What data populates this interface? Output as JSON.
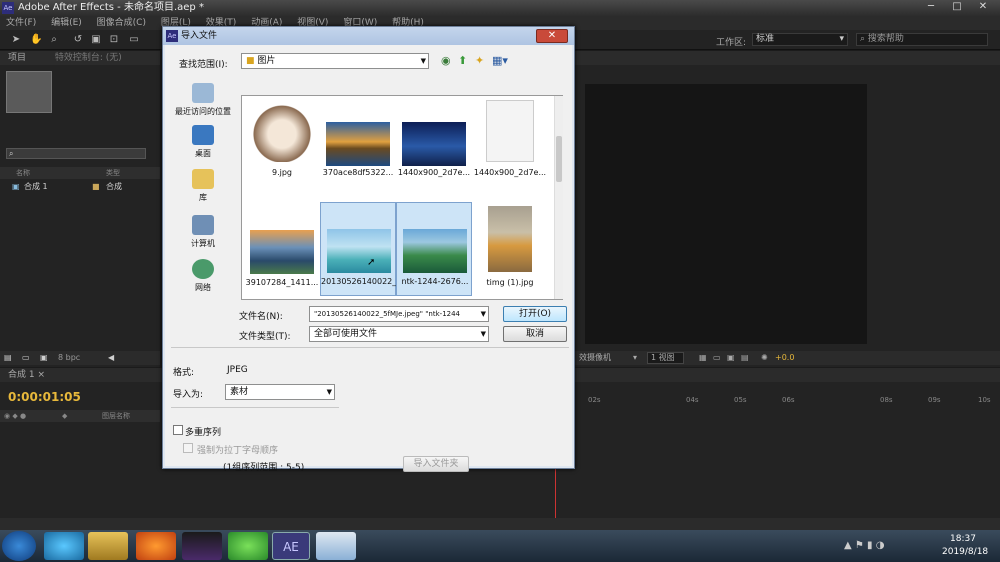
{
  "window": {
    "title": "Adobe After Effects - 未命名项目.aep *",
    "app_icon": "Ae",
    "min": "─",
    "max": "□",
    "close": "✕"
  },
  "menu": [
    "文件(F)",
    "编辑(E)",
    "图像合成(C)",
    "图层(L)",
    "效果(T)",
    "动画(A)",
    "视图(V)",
    "窗口(W)",
    "帮助(H)"
  ],
  "toolbar": {
    "workspace_label": "工作区:",
    "workspace_value": "标准",
    "search_placeholder": "搜索帮助"
  },
  "project": {
    "tab": "项目",
    "tab2": "特效控制台: (无)",
    "col_name": "名称",
    "col_type": "类型",
    "item_name": "合成 1",
    "item_type": "合成",
    "bpc": "8 bpc"
  },
  "viewer": {
    "views": "1 视图",
    "camera": "效摄像机",
    "exposure": "+0.0"
  },
  "timeline": {
    "tab": "合成 1",
    "timecode": "0:00:01:05",
    "layer_name_col": "图层名称",
    "ruler": [
      "02s",
      "04s",
      "05s",
      "06s",
      "08s",
      "09s",
      "10s"
    ]
  },
  "dialog": {
    "title": "导入文件",
    "look_in_label": "查找范围(I):",
    "look_in_value": "图片",
    "places": [
      "最近访问的位置",
      "桌面",
      "库",
      "计算机",
      "网络"
    ],
    "files": [
      {
        "name": "9.jpg"
      },
      {
        "name": "370ace8df5322..."
      },
      {
        "name": "1440x900_2d7e..."
      },
      {
        "name": "1440x900_2d7e..."
      },
      {
        "name": "39107284_1411..."
      },
      {
        "name": "20130526140022_5fMJe.jpeg"
      },
      {
        "name": "ntk-1244-2676..."
      },
      {
        "name": "timg (1).jpg"
      }
    ],
    "filename_label": "文件名(N):",
    "filename_value": "\"20130526140022_5fMJe.jpeg\" \"ntk-1244",
    "filetype_label": "文件类型(T):",
    "filetype_value": "全部可使用文件",
    "open_button": "打开(O)",
    "cancel_button": "取消",
    "format_label": "格式:",
    "format_value": "JPEG",
    "import_as_label": "导入为:",
    "import_as_value": "素材",
    "sequence_label": "多重序列",
    "force_alpha_label": "强制为拉丁字母顺序",
    "range_text": "(1组序列范围 : 5-5)",
    "import_folder_button": "导入文件夹"
  },
  "taskbar": {
    "time": "18:37",
    "date": "2019/8/18",
    "ae_label": "AE"
  }
}
